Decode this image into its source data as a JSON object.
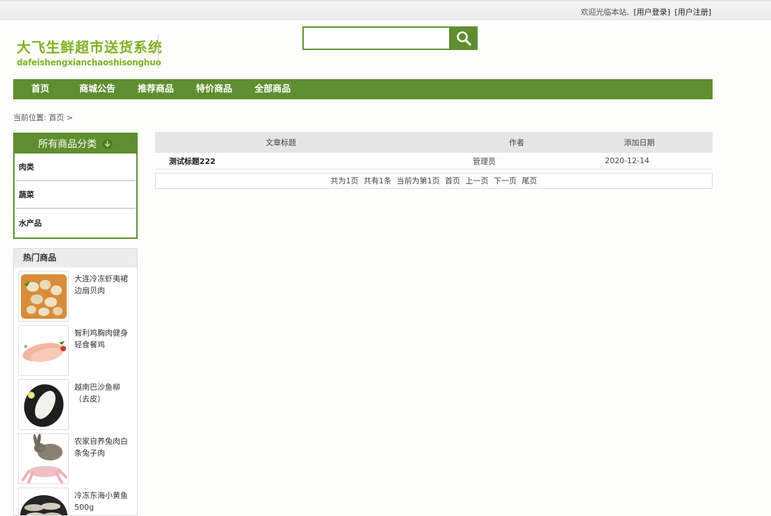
{
  "topbar": {
    "welcome": "欢迎光临本站,",
    "login": "[用户登录]",
    "register": "[用户注册]"
  },
  "logo": {
    "title": "大飞生鲜超市送货系统",
    "subtitle": "dafeishengxianchaoshisonghuo"
  },
  "search": {
    "placeholder": "",
    "value": "",
    "icon": "search-icon"
  },
  "nav": {
    "items": [
      {
        "label": "首页"
      },
      {
        "label": "商城公告"
      },
      {
        "label": "推荐商品"
      },
      {
        "label": "特价商品"
      },
      {
        "label": "全部商品"
      }
    ]
  },
  "breadcrumb": "当前位置: 首页 >",
  "categories": {
    "title": "所有商品分类",
    "icon": "down-arrow-icon",
    "items": [
      {
        "label": "肉类"
      },
      {
        "label": "蔬菜"
      },
      {
        "label": "水产品"
      }
    ]
  },
  "hot": {
    "title": "热门商品",
    "items": [
      {
        "name": "大连冷冻虾夷裙边扇贝肉"
      },
      {
        "name": "智利鸡胸肉健身轻食餐鸡"
      },
      {
        "name": "越南巴沙鱼柳（去皮）"
      },
      {
        "name": "农家自养兔肉白条兔子肉"
      },
      {
        "name": "冷冻东海小黄鱼500g"
      }
    ]
  },
  "table": {
    "headers": {
      "title": "文章标题",
      "author": "作者",
      "date": "添加日期"
    },
    "rows": [
      {
        "title": "测试标题222",
        "author": "管理员",
        "date": "2020-12-14"
      }
    ]
  },
  "pager": {
    "pages": "共为1页",
    "records": "共有1条",
    "current": "当前为第1页",
    "first": "首页",
    "prev": "上一页",
    "next": "下一页",
    "last": "尾页"
  },
  "colors": {
    "brand_green": "#5f8e30",
    "logo_green": "#7fb120"
  }
}
